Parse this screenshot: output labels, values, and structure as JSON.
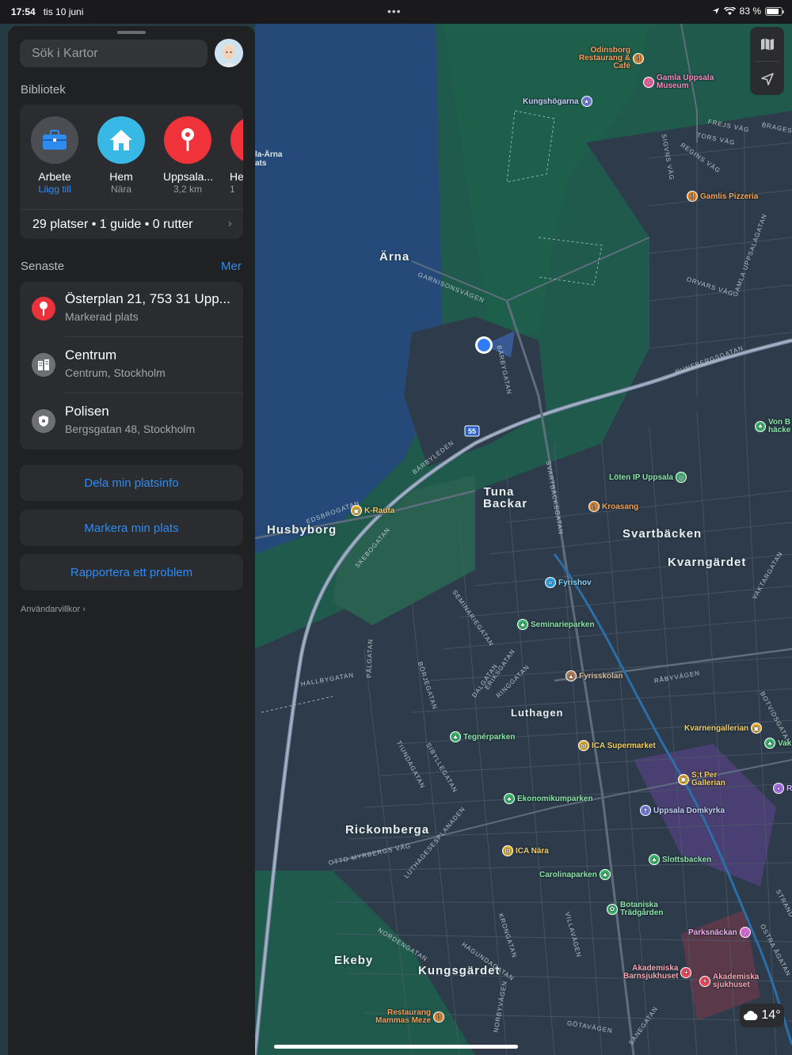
{
  "statusbar": {
    "time": "17:54",
    "date": "tis 10 juni",
    "dots": "•••",
    "battery": "83 %"
  },
  "search": {
    "placeholder": "Sök i Kartor"
  },
  "library": {
    "title": "Bibliotek",
    "favorites": [
      {
        "name": "Arbete",
        "sub": "Lägg till",
        "icon": "briefcase-icon",
        "color": "#4a4d52"
      },
      {
        "name": "Hem",
        "sub": "Nära",
        "icon": "house-icon",
        "color": "#38b8e4"
      },
      {
        "name": "Uppsala...",
        "sub": "3,2 km",
        "icon": "pin-icon",
        "color": "#f0323a"
      },
      {
        "name": "He",
        "sub": "1",
        "icon": "pin-icon",
        "color": "#f0323a"
      }
    ],
    "summary": "29 platser • 1 guide • 0 rutter"
  },
  "recent": {
    "title": "Senaste",
    "more": "Mer",
    "items": [
      {
        "title": "Österplan 21, 753 31 Upp...",
        "sub": "Markerad plats",
        "icon": "pin-icon",
        "color": "#e9323a"
      },
      {
        "title": "Centrum",
        "sub": "Centrum, Stockholm",
        "icon": "building-icon",
        "color": "#6e7073"
      },
      {
        "title": "Polisen",
        "sub": "Bergsgatan 48, Stockholm",
        "icon": "police-badge-icon",
        "color": "#6e7073"
      }
    ]
  },
  "actions": {
    "share": "Dela min platsinfo",
    "mark": "Markera min plats",
    "report": "Rapportera ett problem"
  },
  "terms": "Användarvillkor ›",
  "map": {
    "areas": [
      "Ärna",
      "Tuna Backar",
      "Husbyborg",
      "Svartbäcken",
      "Kvarngärdet",
      "Luthagen",
      "Rickomberga",
      "Ekeby",
      "Kungsgärdet"
    ],
    "streets": [
      "GARNISONSVÄGEN",
      "BÄRBYGATAN",
      "BÄRBYLEDEN",
      "EDSBROGATAN",
      "SKEBOGATAN",
      "SVARTBÄCKSGATAN",
      "RUNEBERGSGATAN",
      "ORVARS VÄG",
      "GAMLA UPPSALAGATAN",
      "FREJS VÄG",
      "TORS VÄG",
      "REGINS VÄG",
      "SIGVNS VÄG",
      "BRAGES V",
      "SEMINARIEGATAN",
      "HALLBYGATAN",
      "PÅLGATAN",
      "BÖRJEGATAN",
      "DALGATAN",
      "ERIKSGATAN",
      "RINGGATAN",
      "RÅBYVÄGEN",
      "TIUNDAGATAN",
      "SIBYLLEGATAN",
      "OTTO MYRBERGS VÄG",
      "LUTHAGESESPLANADEN",
      "NORDENGATAN",
      "HAGUNDAGATAN",
      "KRONGATAN",
      "VILLAVÄGEN",
      "NORBYVÄGEN",
      "GÖTAVÄGEN",
      "SANEGATAN",
      "VAKTARGATAN",
      "BOTVIDSGATAN",
      "ÖSTRA ÅGATAN",
      "STRAND"
    ],
    "route_shield": "55",
    "pois": [
      {
        "label": "Odinsborg Restaurang & Café",
        "lines": [
          "Odinsborg",
          "Restaurang &",
          "Café"
        ],
        "color": "#f08a2a",
        "icon": "fork-knife-icon"
      },
      {
        "label": "Gamla Uppsala Museum",
        "lines": [
          "Gamla Uppsala",
          "Museum"
        ],
        "color": "#e85b9b",
        "icon": "museum-icon"
      },
      {
        "label": "Kungshögarna",
        "color": "#6e7bd9",
        "icon": "star-icon"
      },
      {
        "label": "Gamlis Pizzeria",
        "color": "#f08a2a",
        "icon": "fork-knife-icon"
      },
      {
        "label": "la-Ärna",
        "sub": "ats"
      },
      {
        "label": "Von B",
        "sub": "häcke",
        "color": "#3ab56b",
        "icon": "tree-icon"
      },
      {
        "label": "Löten IP Uppsala",
        "color": "#3ab56b",
        "icon": "sports-icon"
      },
      {
        "label": "K-Rauta",
        "color": "#f0b429",
        "icon": "shopping-icon"
      },
      {
        "label": "Kroasang",
        "color": "#f08a2a",
        "icon": "fork-knife-icon"
      },
      {
        "label": "Fyrishov",
        "color": "#2fa0e6",
        "icon": "swim-icon"
      },
      {
        "label": "Seminarieparken",
        "color": "#3ab56b",
        "icon": "tree-icon"
      },
      {
        "label": "Fyrisskolan",
        "color": "#b07a5a",
        "icon": "school-icon"
      },
      {
        "label": "Kvarnengallerian",
        "color": "#f0b429",
        "icon": "shopping-icon"
      },
      {
        "label": "Tegnérparken",
        "color": "#3ab56b",
        "icon": "tree-icon"
      },
      {
        "label": "ICA Supermarket",
        "color": "#f0b429",
        "icon": "cart-icon"
      },
      {
        "label": "Vak",
        "color": "#3ab56b",
        "icon": "tree-icon"
      },
      {
        "label": "S:t Per Gallerian",
        "lines": [
          "S:t Per",
          "Gallerian"
        ],
        "color": "#f0b429",
        "icon": "shopping-icon"
      },
      {
        "label": "R",
        "color": "#a06be0",
        "icon": "dot-icon"
      },
      {
        "label": "Ekonomikumparken",
        "color": "#3ab56b",
        "icon": "tree-icon"
      },
      {
        "label": "Uppsala Domkyrka",
        "color": "#6e7bd9",
        "icon": "church-icon"
      },
      {
        "label": "ICA Nära",
        "color": "#f0b429",
        "icon": "cart-icon"
      },
      {
        "label": "Slottsbacken",
        "color": "#3ab56b",
        "icon": "tree-icon"
      },
      {
        "label": "Carolinaparken",
        "color": "#3ab56b",
        "icon": "tree-icon"
      },
      {
        "label": "Botaniska Trädgården",
        "lines": [
          "Botaniska",
          "Trädgården"
        ],
        "color": "#3ab56b",
        "icon": "flower-icon"
      },
      {
        "label": "Parksnäckan",
        "color": "#d46ad1",
        "icon": "music-icon"
      },
      {
        "label": "Akademiska Barnsjukhuset",
        "lines": [
          "Akademiska",
          "Barnsjukhuset"
        ],
        "color": "#e84a5f",
        "icon": "hospital-icon"
      },
      {
        "label": "Akademiska sjukhuset",
        "lines": [
          "Akademiska",
          "sjukhuset"
        ],
        "color": "#e84a5f",
        "icon": "hospital-icon"
      },
      {
        "label": "Restaurang Mammas Meze",
        "lines": [
          "Restaurang",
          "Mammas Meze"
        ],
        "color": "#f08a2a",
        "icon": "fork-knife-icon"
      }
    ]
  },
  "weather": {
    "temp": "14°",
    "icon": "cloud-icon"
  }
}
